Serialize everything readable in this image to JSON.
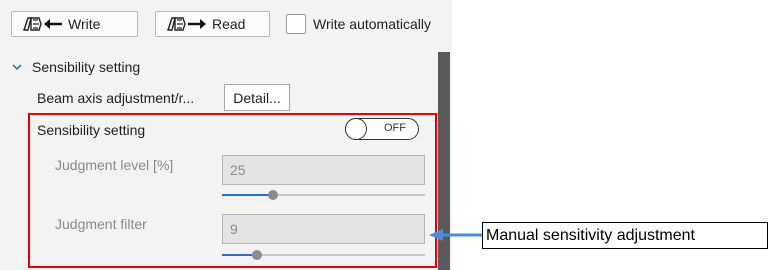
{
  "toolbar": {
    "write_label": "Write",
    "read_label": "Read",
    "write_auto_label": "Write automatically",
    "write_auto_checked": false,
    "write_icon": "sensor-arrow-left-icon",
    "read_icon": "sensor-arrow-right-icon"
  },
  "section": {
    "title": "Sensibility setting",
    "expanded": true,
    "chevron_icon": "chevron-down-icon"
  },
  "beam_axis": {
    "label": "Beam axis adjustment/r...",
    "detail_label": "Detail..."
  },
  "sensibility": {
    "label": "Sensibility setting",
    "toggle_text": "OFF",
    "toggle_on": false
  },
  "judgment_level": {
    "label": "Judgment level [%]",
    "value": "25",
    "slider_fraction": 0.25
  },
  "judgment_filter": {
    "label": "Judgment filter",
    "value": "9",
    "slider_fraction": 0.17
  },
  "annotation": {
    "callout_text": "Manual sensitivity adjustment",
    "highlight_color": "#e60000",
    "arrow_color": "#4a8fd6"
  }
}
